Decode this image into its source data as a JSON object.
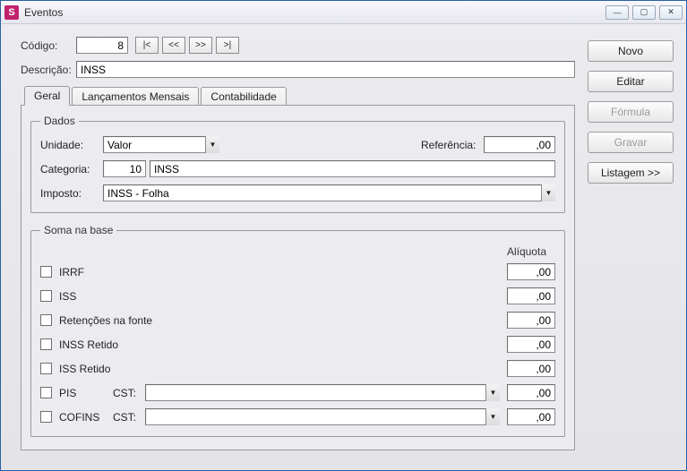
{
  "window": {
    "title": "Eventos",
    "icon_letter": "S",
    "min_btn": "—",
    "max_btn": "▢",
    "close_btn": "✕"
  },
  "header": {
    "codigo_label": "Código:",
    "codigo_value": "8",
    "nav": {
      "first": "|<",
      "prev": "<<",
      "next": ">>",
      "last": ">|"
    },
    "descricao_label": "Descrição:",
    "descricao_value": "INSS"
  },
  "right_buttons": {
    "novo": "Novo",
    "editar": "Editar",
    "formula": "Fórmula",
    "gravar": "Gravar",
    "listagem": "Listagem >>"
  },
  "tabs": {
    "geral": "Geral",
    "lanc": "Lançamentos Mensais",
    "contab": "Contabilidade"
  },
  "dados": {
    "legend": "Dados",
    "unidade_label": "Unidade:",
    "unidade_value": "Valor",
    "referencia_label": "Referência:",
    "referencia_value": ",00",
    "categoria_label": "Categoria:",
    "categoria_num": "10",
    "categoria_nome": "INSS",
    "imposto_label": "Imposto:",
    "imposto_value": "INSS - Folha"
  },
  "soma": {
    "legend": "Soma na base",
    "aliquota_header": "Alíquota",
    "cst_label": "CST:",
    "rows": {
      "irrf": {
        "label": "IRRF",
        "aliq": ",00"
      },
      "iss": {
        "label": "ISS",
        "aliq": ",00"
      },
      "ret": {
        "label": "Retenções na fonte",
        "aliq": ",00"
      },
      "inssr": {
        "label": "INSS Retido",
        "aliq": ",00"
      },
      "issr": {
        "label": "ISS Retido",
        "aliq": ",00"
      },
      "pis": {
        "label": "PIS",
        "aliq": ",00",
        "cst": ""
      },
      "cofins": {
        "label": "COFINS",
        "aliq": ",00",
        "cst": ""
      }
    }
  }
}
